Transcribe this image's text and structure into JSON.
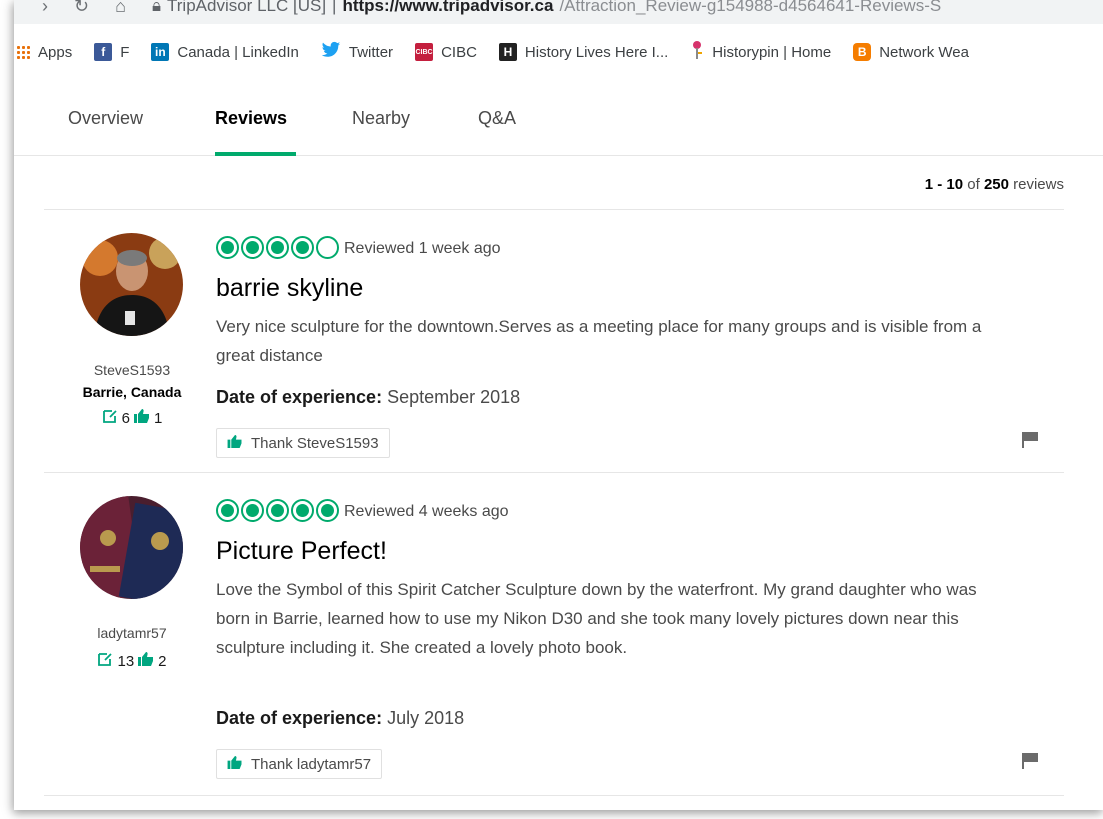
{
  "browser": {
    "url_prefix": "TripAdvisor LLC [US]",
    "url_host": "https://www.tripadvisor.ca",
    "url_path": "/Attraction_Review-g154988-d4564641-Reviews-S"
  },
  "bookmarks": [
    {
      "label": "Apps",
      "icon": "apps-icon",
      "color": "#e8710a"
    },
    {
      "label": "F",
      "icon": "facebook-icon",
      "color": "#3b5998"
    },
    {
      "label": "Canada | LinkedIn",
      "icon": "linkedin-icon",
      "color": "#0077b5"
    },
    {
      "label": "Twitter",
      "icon": "twitter-icon",
      "color": "#1da1f2"
    },
    {
      "label": "CIBC",
      "icon": "cibc-icon",
      "color": "#c41f3e"
    },
    {
      "label": "History Lives Here I...",
      "icon": "history-icon",
      "color": "#222222"
    },
    {
      "label": "Historypin | Home",
      "icon": "historypin-icon",
      "color": "#d6336c"
    },
    {
      "label": "Network Wea",
      "icon": "blogger-icon",
      "color": "#f57d00"
    }
  ],
  "tabs": [
    {
      "label": "Overview",
      "active": false
    },
    {
      "label": "Reviews",
      "active": true
    },
    {
      "label": "Nearby",
      "active": false
    },
    {
      "label": "Q&A",
      "active": false
    }
  ],
  "review_count": {
    "range": "1 - 10",
    "of": "of",
    "total": "250",
    "suffix": "reviews"
  },
  "reviews": [
    {
      "username": "SteveS1593",
      "location": "Barrie, Canada",
      "contributions": "6",
      "helpful_votes": "1",
      "rating": 4,
      "reviewed": "Reviewed 1 week ago",
      "title": "barrie skyline",
      "body": "Very nice sculpture for the downtown.Serves as a meeting place for many groups and is visible from a great distance",
      "doe_label": "Date of experience:",
      "doe_value": "September 2018",
      "thank_label": "Thank SteveS1593"
    },
    {
      "username": "ladytamr57",
      "location": "",
      "contributions": "13",
      "helpful_votes": "2",
      "rating": 5,
      "reviewed": "Reviewed 4 weeks ago",
      "title": "Picture Perfect!",
      "body": "Love the Symbol of this Spirit Catcher Sculpture down by the waterfront. My grand daughter who was born in Barrie, learned how to use my Nikon D30 and she took many lovely pictures down near this sculpture including it. She created a lovely photo book.",
      "doe_label": "Date of experience:",
      "doe_value": "July 2018",
      "thank_label": "Thank ladytamr57"
    }
  ],
  "colors": {
    "accent": "#00aa6c",
    "text": "#4a4a4a"
  }
}
